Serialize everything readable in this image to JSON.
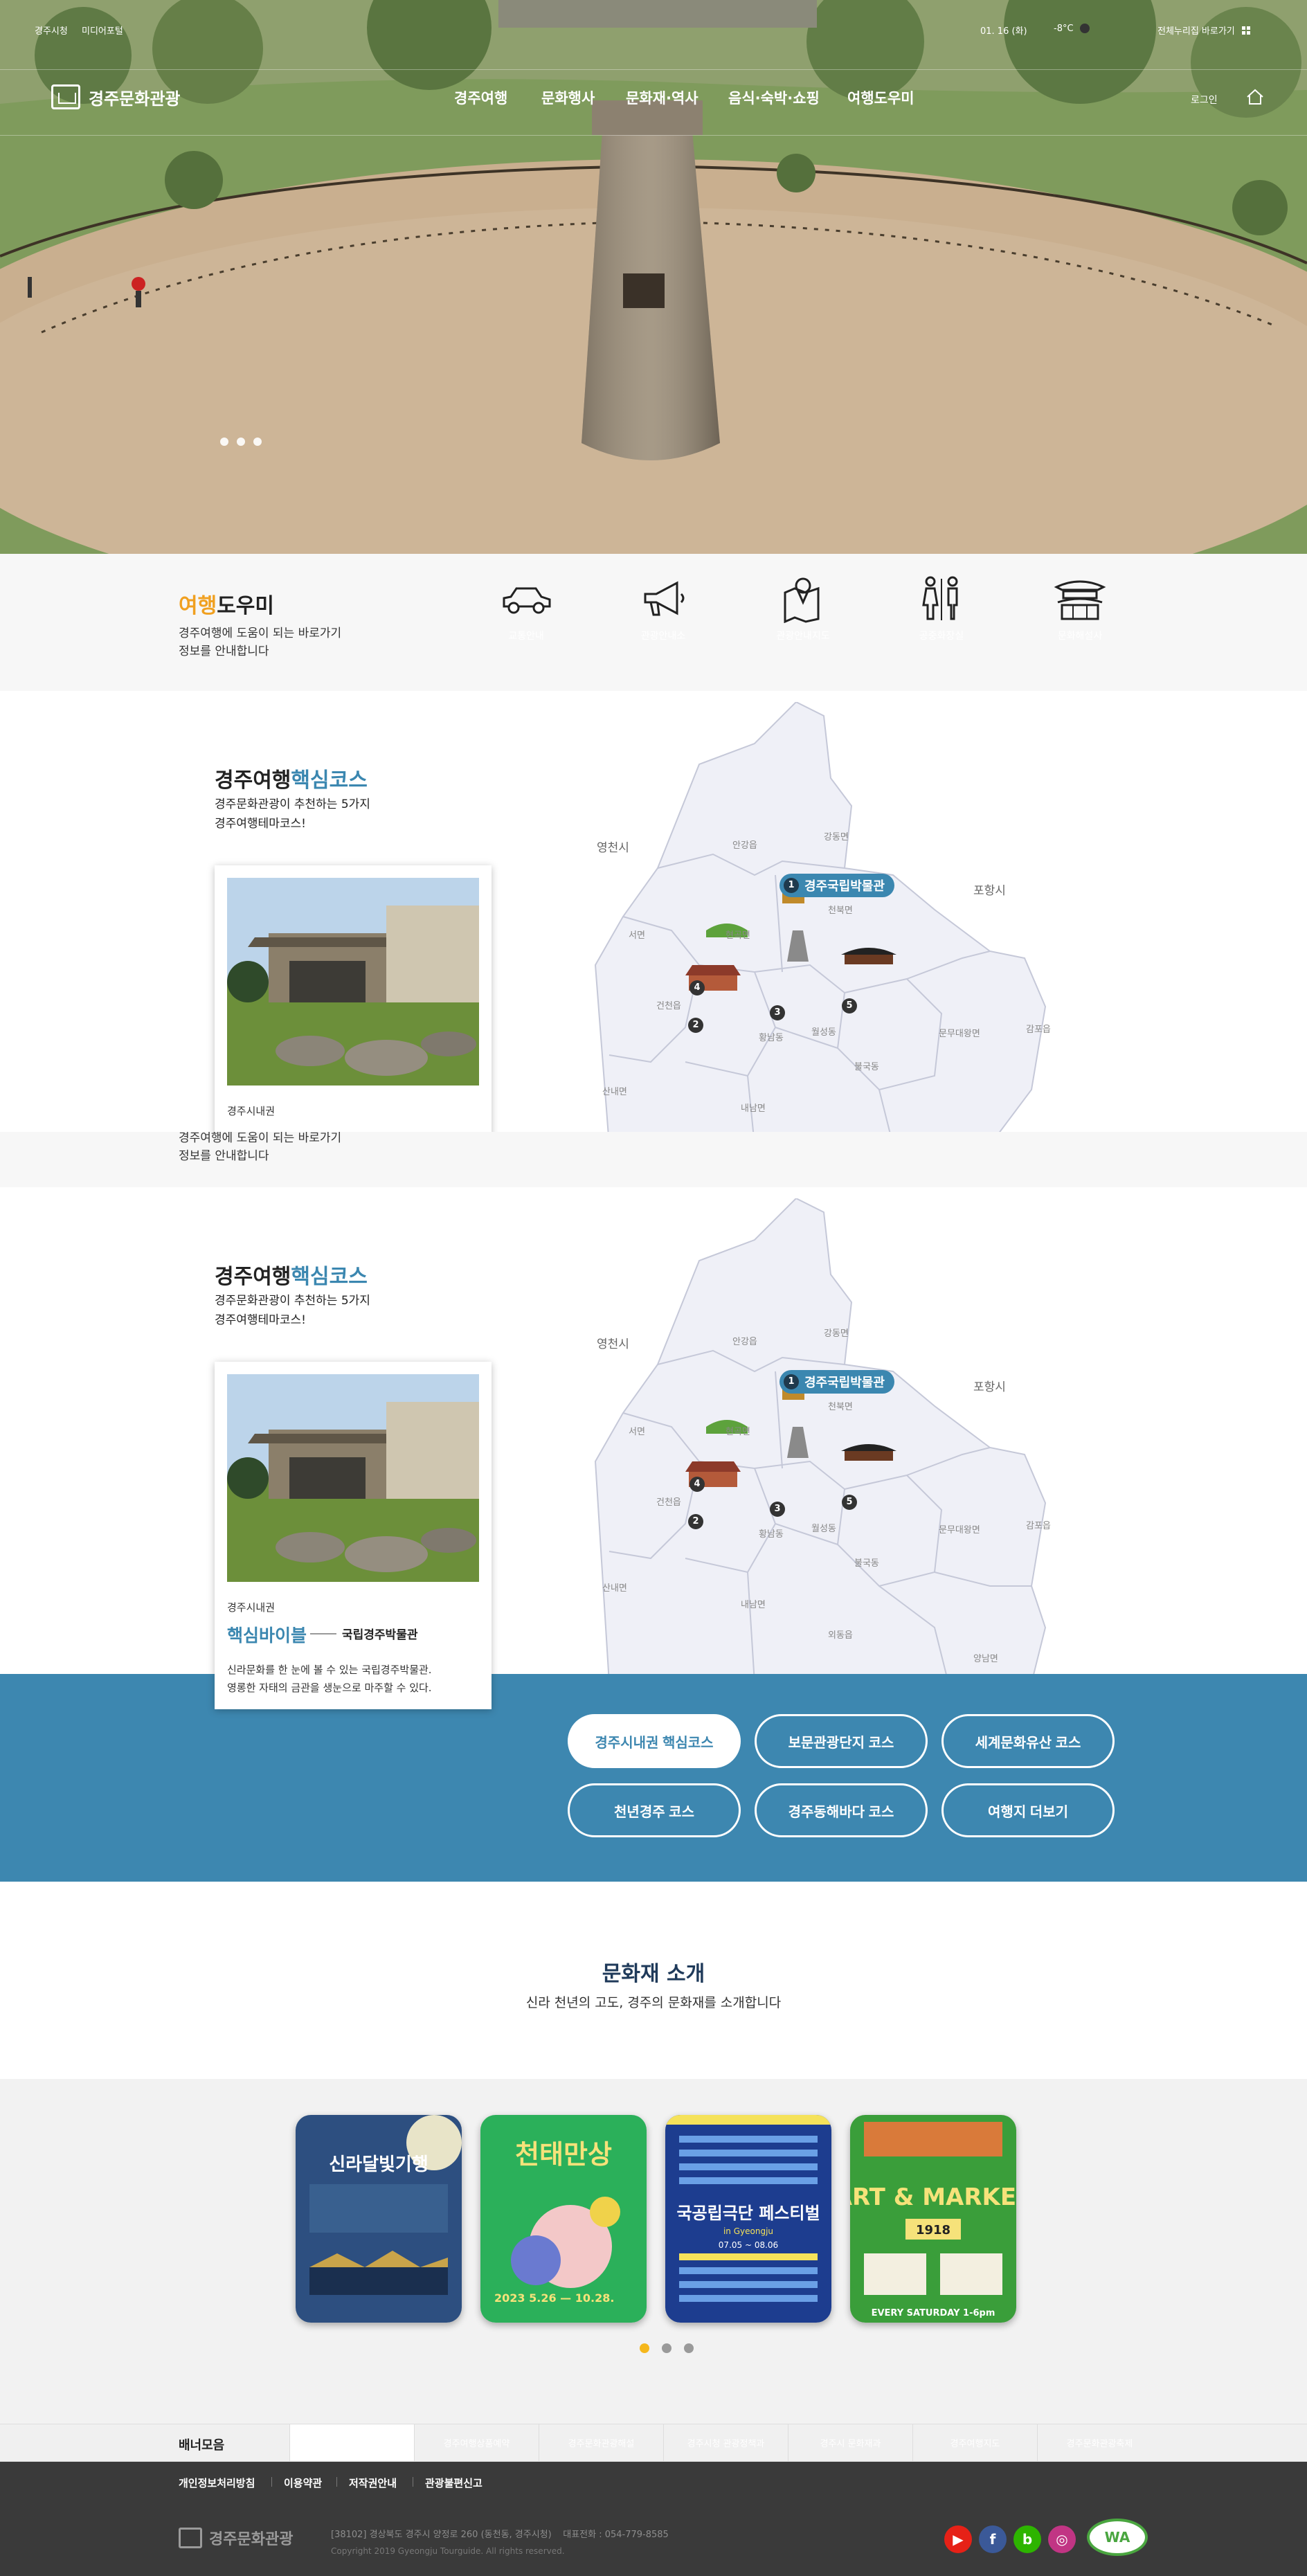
{
  "topbar": {
    "site_link_1": "경주시청",
    "site_link_2": "미디어포털",
    "date": "01. 16 (화)",
    "weather": "-8°C",
    "sitemap": "전체누리집 바로가기"
  },
  "header": {
    "logo_text": "경주문화관광",
    "nav": [
      "경주여행",
      "문화행사",
      "문화재·역사",
      "음식·숙박·쇼핑",
      "여행도우미"
    ],
    "login": "로그인"
  },
  "helper": {
    "title_highlight": "여행",
    "title_rest": "도우미",
    "desc_line1": "경주여행에 도움이 되는 바로가기",
    "desc_line2": "정보를 안내합니다",
    "items": [
      {
        "icon": "car-icon",
        "label": "교통안내"
      },
      {
        "icon": "megaphone-icon",
        "label": "관광안내소"
      },
      {
        "icon": "map-icon",
        "label": "관광안내지도"
      },
      {
        "icon": "restroom-icon",
        "label": "공중화장실"
      },
      {
        "icon": "heritage-icon",
        "label": "문화해설사"
      }
    ]
  },
  "course": {
    "title_prefix": "경주여행",
    "title_highlight": "핵심코스",
    "desc_line1": "경주문화관광이 추천하는 5가지",
    "desc_line2": "경주여행테마코스!",
    "card": {
      "area": "경주시내권",
      "bible": "핵심바이블",
      "museum": "국립경주박물관",
      "text_line1": "신라문화를 한 눈에 볼 수 있는 국립경주박물관.",
      "text_line2": "영롱한 자태의 금관을 생눈으로 마주할 수 있다."
    },
    "map": {
      "cities": [
        "영천시",
        "포항시"
      ],
      "towns": [
        "안강읍",
        "강동면",
        "천북면",
        "서면",
        "현곡면",
        "건천읍",
        "황남동",
        "월성동",
        "불국동",
        "문무대왕면",
        "감포읍",
        "산내면",
        "내남면",
        "외동읍",
        "양남면"
      ],
      "pin_number": "1",
      "pin_label": "경주국립박물관",
      "markers": [
        "2",
        "3",
        "4",
        "5"
      ]
    }
  },
  "course_buttons": [
    "경주시내권 핵심코스",
    "보문관광단지 코스",
    "세계문화유산 코스",
    "천년경주 코스",
    "경주동해바다 코스",
    "여행지 더보기"
  ],
  "heritage": {
    "title": "문화재 소개",
    "subtitle": "신라 천년의 고도, 경주의 문화재를 소개합니다"
  },
  "posters": [
    {
      "title": "신라달빛기행",
      "color": "#2d4f80"
    },
    {
      "title": "천태만상",
      "color": "#2bb05a"
    },
    {
      "title": "국공립극단 페스티벌",
      "color": "#1d3d8f"
    },
    {
      "title": "ART & MARKET",
      "color": "#3a9e3a"
    }
  ],
  "poster_text": {
    "p2_date": "2023 5.26 — 10.28.",
    "p3_sub": "in Gyeongju",
    "p3_dates": "07.05 ~ 08.06",
    "p4_year": "1918",
    "p4_when": "EVERY SATURDAY 1-6pm"
  },
  "banners": {
    "title": "배너모음",
    "items": [
      "",
      "경주여행상품예약",
      "경주문화관광해설",
      "경주시청 관광정책과",
      "경주시 문화재과",
      "경주여행지도",
      "경주문화관광축제"
    ]
  },
  "footer": {
    "links": [
      "개인정보처리방침",
      "이용약관",
      "저작권안내",
      "관광불편신고"
    ],
    "logo_text": "경주문화관광",
    "address": "[38102] 경상북도 경주시 양정로 260 (동천동, 경주시청)",
    "phone": "대표전화 : 054-779-8585",
    "copyright": "Copyright 2019 Gyeongju Tourguide. All rights reserved.",
    "sns": [
      {
        "icon": "youtube-icon",
        "glyph": "▶",
        "color": "#e62117"
      },
      {
        "icon": "facebook-icon",
        "glyph": "f",
        "color": "#3b5998"
      },
      {
        "icon": "blog-icon",
        "glyph": "b",
        "color": "#2db400"
      },
      {
        "icon": "instagram-icon",
        "glyph": "◎",
        "color": "#c13584"
      }
    ],
    "wa_mark": "WA"
  }
}
